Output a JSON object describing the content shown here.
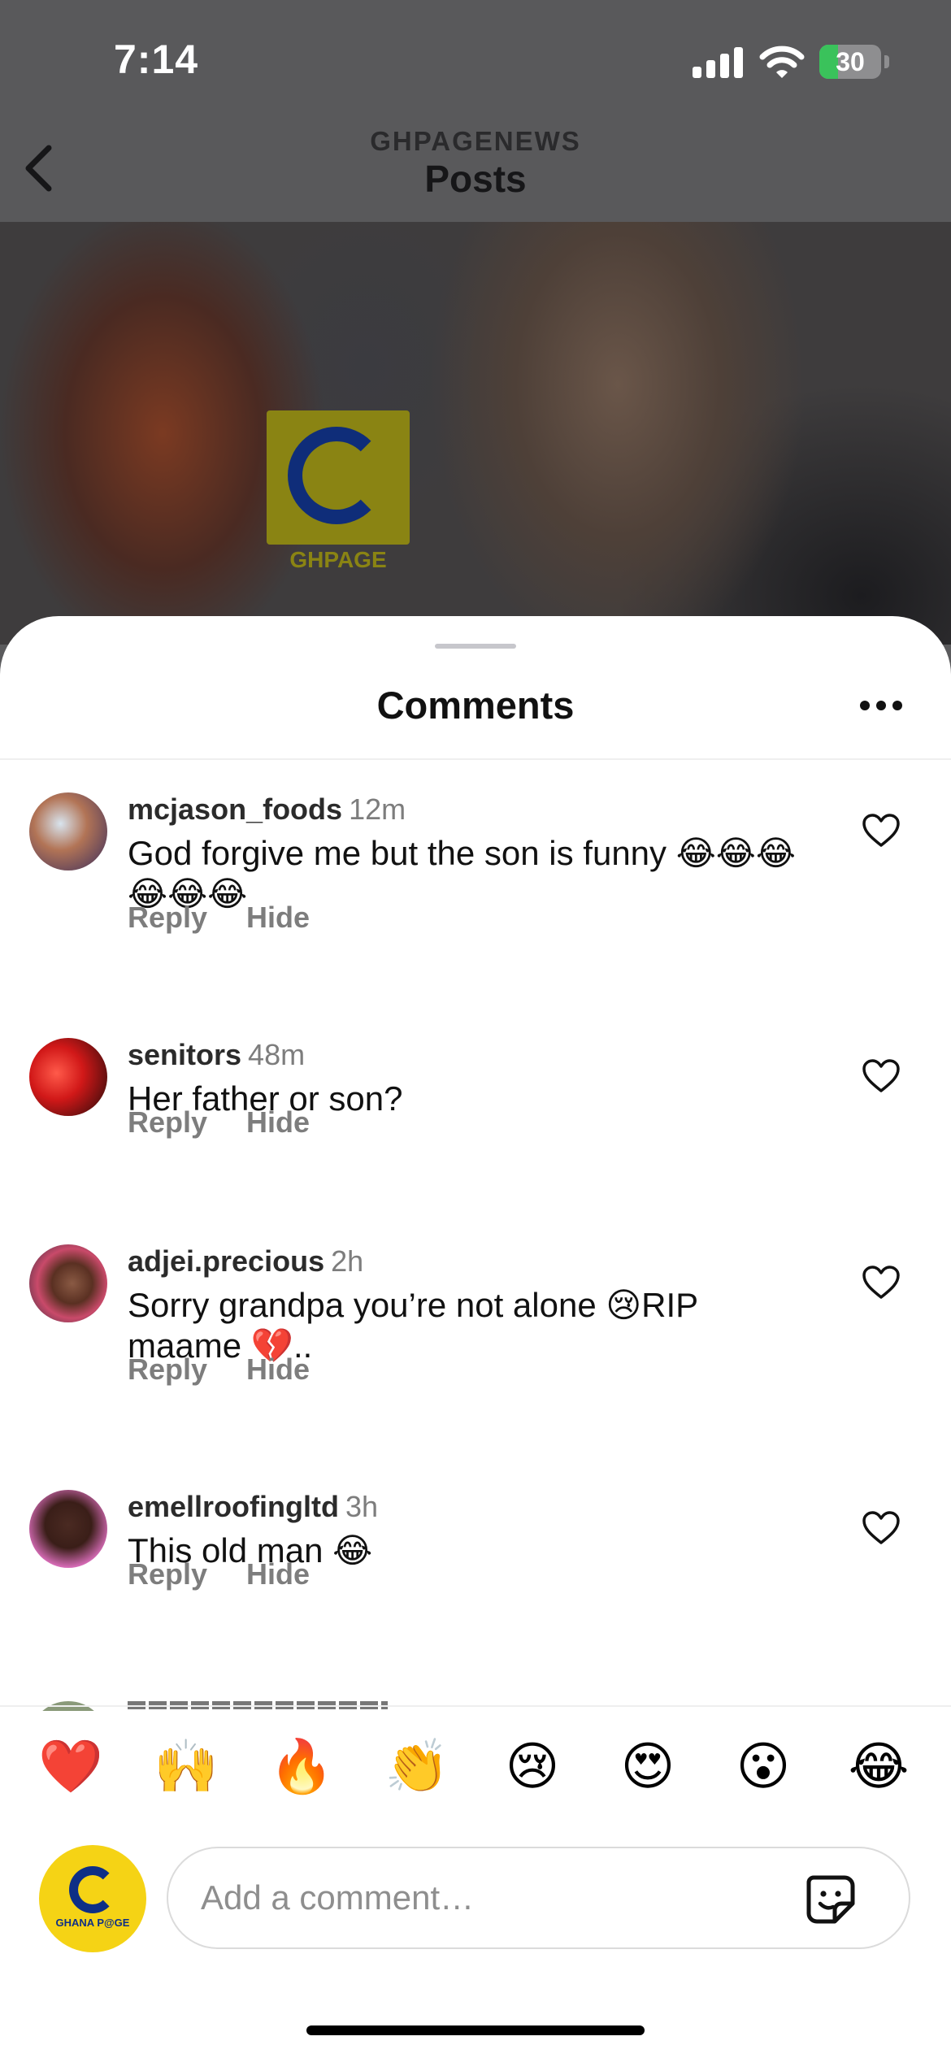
{
  "status_bar": {
    "time": "7:14",
    "battery": "30",
    "battery_level": 0.3
  },
  "nav": {
    "subtitle": "GHPAGENEWS",
    "title": "Posts"
  },
  "post_image": {
    "watermark": "GHPAGE"
  },
  "sheet": {
    "title": "Comments"
  },
  "comments": [
    {
      "username": "mcjason_foods",
      "time": "12m",
      "text": "God forgive me but the son is funny 😂😂😂😂😂😂",
      "reply": "Reply",
      "hide": "Hide"
    },
    {
      "username": "senitors",
      "time": "48m",
      "text": "Her father or son?",
      "reply": "Reply",
      "hide": "Hide"
    },
    {
      "username": "adjei.precious",
      "time": "2h",
      "text": "Sorry grandpa you’re not alone 😢RIP maame 💔..",
      "reply": "Reply",
      "hide": "Hide"
    },
    {
      "username": "emellroofingltd",
      "time": "3h",
      "text": "This old man 😂",
      "reply": "Reply",
      "hide": "Hide"
    }
  ],
  "reactions": [
    "❤️",
    "🙌",
    "🔥",
    "👏",
    "😢",
    "😍",
    "😮",
    "😂"
  ],
  "composer": {
    "placeholder": "Add a comment…",
    "avatar_label": "GHANA P@GE"
  },
  "colors": {
    "heart_icon": "#111111",
    "accent_yellow": "#f5d315",
    "brand_blue": "#0e2f86",
    "battery_green": "#3ac25b"
  }
}
